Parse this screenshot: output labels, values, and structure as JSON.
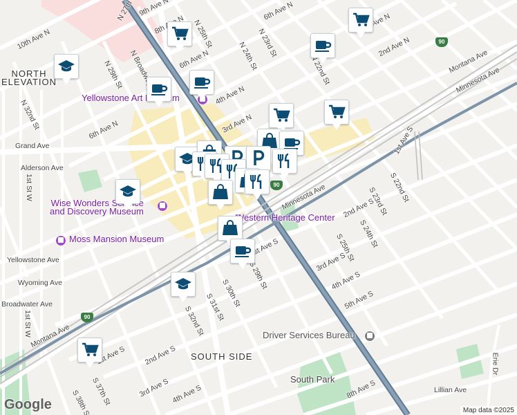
{
  "colors": {
    "background": "#f2f1ee",
    "road": "#ffffff",
    "railway": "#5f7b94",
    "park": "#bfe3c5",
    "commercial": "#f8ebbc",
    "district": "#fadddd",
    "pin_icon": "#0e4d73",
    "poi_label": "#7b1fa2"
  },
  "areas": {
    "north_elevation": "NORTH\nELEVATION",
    "south_side": "SOUTH SIDE"
  },
  "pois": {
    "yellowstone_art_museum": "Yellowstone Art Museum",
    "wise_wonders": "Wise Wonders Science\nand Discovery Museum",
    "moss_mansion": "Moss Mansion Museum",
    "western_heritage": "Western Heritage Center",
    "driver_services": "Driver Services Bureau",
    "south_park": "South Park"
  },
  "streets": {
    "ave_10_n": "10th Ave N",
    "ave_9_n": "9th Ave N",
    "ave_8_n": "8th Ave N",
    "ave_6_n_top": "6th Ave N",
    "ave_6_n": "6th Ave N",
    "ave_4_n": "4th Ave N",
    "ave_3_n": "3rd Ave N",
    "ave_2_n": "2nd Ave N",
    "ave_3rd_top": "3rd Ave N",
    "ave_6th_top": "6th Ave N",
    "n_27th": "N 27th St",
    "n_25th": "N 25th St",
    "n_24th": "N 24th St",
    "n_23rd": "N 23rd St",
    "n_22nd": "N 22nd St",
    "n_29th": "N 29th St",
    "n_32nd": "N 32nd St",
    "n_broadway": "N Broadway",
    "montana_ave_top": "Montana Ave",
    "minnesota_ave_top": "Minnesota Ave",
    "minnesota_ave": "Minnesota Ave",
    "grand_ave": "Grand Ave",
    "alderson_ave": "Alderson Ave",
    "first_st_w_top": "1st St W",
    "first_st_w": "1st St W",
    "yellowstone_ave": "Yellowstone Ave",
    "wyoming_ave": "Wyoming Ave",
    "broadwater_ave": "Broadwater Ave",
    "montana_ave": "Montana Ave",
    "first_ave_s": "1st Ave S",
    "first_ave_s_mid": "1st Ave S",
    "first_ave_s_right": "1st Ave S",
    "second_ave_s": "2nd Ave S",
    "second_ave_s_right": "2nd Ave S",
    "third_ave_s": "3rd Ave S",
    "third_ave_s_right": "3rd Ave S",
    "fourth_ave_s": "4th Ave S",
    "fourth_ave_s_right": "4th Ave S",
    "fifth_ave_s": "5th Ave S",
    "eighth_ave_s": "8th Ave S",
    "s_22nd": "S 22nd St",
    "s_23rd": "S 23rd St",
    "s_24th": "S 24th St",
    "s_25th": "S 25th St",
    "s_29th": "S 29th St",
    "s_30th": "S 30th St",
    "s_31st": "S 31st St",
    "s_32nd": "S 32nd St",
    "s_37th": "S 37th St",
    "s_38th": "S 38th St",
    "lillian_ave": "Lillian Ave",
    "erie_dr": "Erie Dr"
  },
  "highways": {
    "i90_top": "90",
    "i90_mid": "90",
    "i90_bottom": "90"
  },
  "markers": [
    {
      "icon": "shopping-cart"
    },
    {
      "icon": "shopping-cart"
    },
    {
      "icon": "coffee-cup"
    },
    {
      "icon": "graduation-cap"
    },
    {
      "icon": "coffee-cup"
    },
    {
      "icon": "coffee-cup"
    },
    {
      "icon": "shopping-cart"
    },
    {
      "icon": "shopping-cart"
    },
    {
      "icon": "shopping-bag"
    },
    {
      "icon": "coffee-cup"
    },
    {
      "icon": "graduation-cap"
    },
    {
      "icon": "shopping-bag"
    },
    {
      "icon": "fork-knife"
    },
    {
      "icon": "parking"
    },
    {
      "icon": "parking"
    },
    {
      "icon": "fork-knife"
    },
    {
      "icon": "fork-knife"
    },
    {
      "icon": "fork-knife"
    },
    {
      "icon": "shopping-bag"
    },
    {
      "icon": "fork-knife"
    },
    {
      "icon": "graduation-cap"
    },
    {
      "icon": "shopping-bag"
    },
    {
      "icon": "coffee-cup"
    },
    {
      "icon": "graduation-cap"
    },
    {
      "icon": "shopping-cart"
    }
  ],
  "branding": {
    "logo": "Google",
    "attribution": "Map data ©2025"
  }
}
